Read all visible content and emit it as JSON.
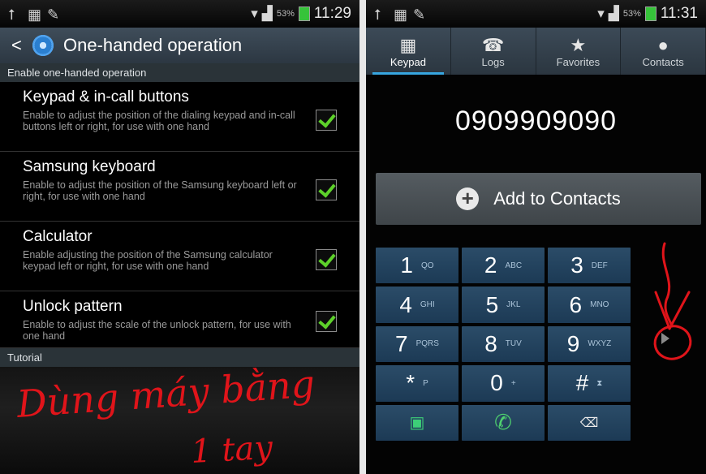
{
  "left_phone": {
    "status_time": "11:29",
    "battery": "53%",
    "title": "One-handed operation",
    "section_enable": "Enable one-handed operation",
    "settings": [
      {
        "title": "Keypad & in-call buttons",
        "desc": "Enable to adjust the position of the dialing keypad and in-call buttons left or right, for use with one hand",
        "checked": true
      },
      {
        "title": "Samsung keyboard",
        "desc": "Enable to adjust the position of the Samsung keyboard left or right, for use with one hand",
        "checked": true
      },
      {
        "title": "Calculator",
        "desc": "Enable adjusting the position of the Samsung calculator keypad left or right, for use with one hand",
        "checked": true
      },
      {
        "title": "Unlock pattern",
        "desc": "Enable to adjust the scale of the unlock pattern, for use with one hand",
        "checked": true
      }
    ],
    "section_tutorial": "Tutorial",
    "handwriting": [
      "Dùng máy bằng",
      "1 tay"
    ]
  },
  "right_phone": {
    "status_time": "11:31",
    "battery": "53%",
    "tabs": [
      "Keypad",
      "Logs",
      "Favorites",
      "Contacts"
    ],
    "active_tab": "Keypad",
    "number": "0909909090",
    "add_label": "Add to Contacts",
    "keys": [
      {
        "d": "1",
        "l": "QO"
      },
      {
        "d": "2",
        "l": "ABC"
      },
      {
        "d": "3",
        "l": "DEF"
      },
      {
        "d": "4",
        "l": "GHI"
      },
      {
        "d": "5",
        "l": "JKL"
      },
      {
        "d": "6",
        "l": "MNO"
      },
      {
        "d": "7",
        "l": "PQRS"
      },
      {
        "d": "8",
        "l": "TUV"
      },
      {
        "d": "9",
        "l": "WXYZ"
      },
      {
        "d": "*",
        "l": "P"
      },
      {
        "d": "0",
        "l": "+"
      },
      {
        "d": "#",
        "l": ""
      }
    ]
  },
  "colors": {
    "check": "#5dd12a",
    "annotation": "#e0141a",
    "tab_indicator": "#37a6e0"
  }
}
